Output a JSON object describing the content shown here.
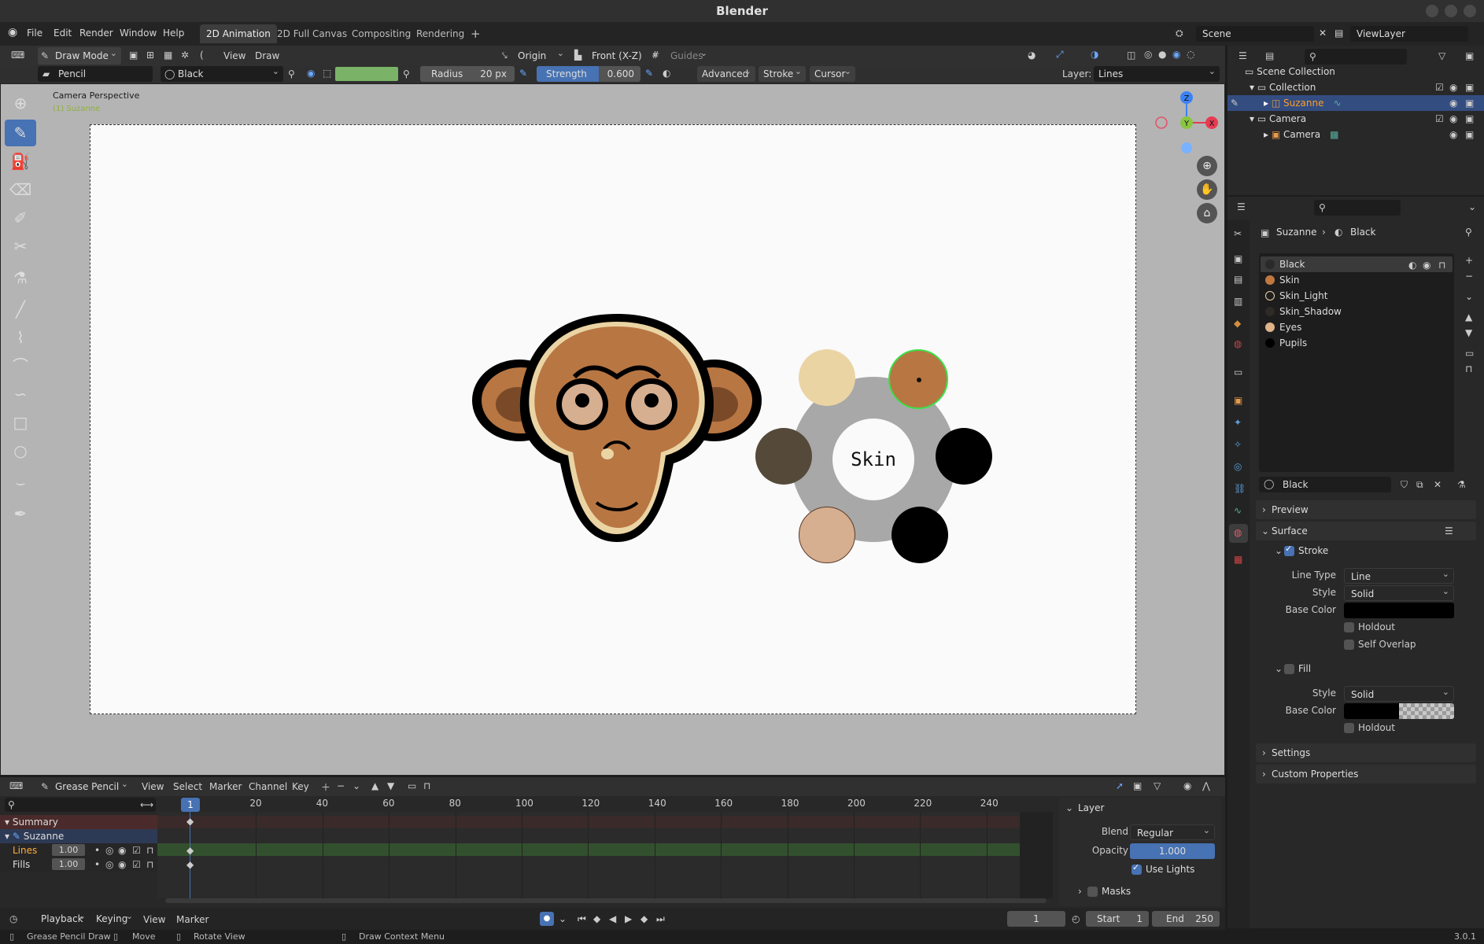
{
  "window": {
    "title": "Blender",
    "version": "3.0.1"
  },
  "menus": [
    "File",
    "Edit",
    "Render",
    "Window",
    "Help"
  ],
  "workspaces": [
    "2D Animation",
    "2D Full Canvas",
    "Compositing",
    "Rendering"
  ],
  "workspace_add": "+",
  "scene": {
    "scene_name": "Scene",
    "view_layer": "ViewLayer"
  },
  "header": {
    "mode": "Draw Mode",
    "view_menu": "View",
    "draw_menu": "Draw",
    "origin": "Origin",
    "projection": "Front (X-Z)",
    "guides": "Guides"
  },
  "tool_settings": {
    "brush": "Pencil",
    "material": "Black",
    "radius_label": "Radius",
    "radius_value": "20 px",
    "strength_label": "Strength",
    "strength_value": "0.600",
    "advanced": "Advanced",
    "stroke": "Stroke",
    "cursor": "Cursor",
    "layer_label": "Layer:",
    "layer_value": "Lines",
    "vertex_color": "#7ab368"
  },
  "viewport": {
    "perspective_label": "Camera Perspective",
    "object_label": "(1) Suzanne",
    "pie_center_label": "Skin",
    "gizmo": {
      "z": "Z",
      "y": "Y",
      "x": "X"
    }
  },
  "pie_colors": {
    "skin_light": "#ebd4a4",
    "skin": "#b87643",
    "skin_shadow": "#554a3a",
    "pupils": "#000000",
    "eyes": "#d6ae90",
    "black": "#000000",
    "ring": "#a8a8a8"
  },
  "outliner": {
    "rows": [
      {
        "label": "Scene Collection"
      },
      {
        "label": "Collection"
      },
      {
        "label": "Suzanne"
      },
      {
        "label": "Camera"
      },
      {
        "label": "Camera"
      }
    ]
  },
  "properties": {
    "breadcrumb_object": "Suzanne",
    "breadcrumb_material": "Black",
    "materials": [
      {
        "name": "Black",
        "color": "#2a2a2a"
      },
      {
        "name": "Skin",
        "color": "#c07840"
      },
      {
        "name": "Skin_Light",
        "color": "#1e1e1e"
      },
      {
        "name": "Skin_Shadow",
        "color": "#2e2a26"
      },
      {
        "name": "Eyes",
        "color": "#e0b488"
      },
      {
        "name": "Pupils",
        "color": "#000000"
      }
    ],
    "material_name": "Black",
    "sections": {
      "preview": "Preview",
      "surface": "Surface",
      "stroke": "Stroke",
      "fill": "Fill",
      "settings": "Settings",
      "custom_properties": "Custom Properties"
    },
    "stroke": {
      "line_type_label": "Line Type",
      "line_type": "Line",
      "style_label": "Style",
      "style": "Solid",
      "base_color_label": "Base Color",
      "holdout": "Holdout",
      "self_overlap": "Self Overlap"
    },
    "fill": {
      "style_label": "Style",
      "style": "Solid",
      "base_color_label": "Base Color",
      "holdout": "Holdout"
    }
  },
  "timeline": {
    "editor": "Grease Pencil",
    "menus": [
      "View",
      "Select",
      "Marker",
      "Channel",
      "Key"
    ],
    "frame_markers": [
      "20",
      "40",
      "60",
      "80",
      "100",
      "120",
      "140",
      "160",
      "180",
      "200",
      "220",
      "240"
    ],
    "current_frame_badge": "1",
    "channels": [
      {
        "label": "Summary"
      },
      {
        "label": "Suzanne"
      },
      {
        "label": "Lines",
        "value": "1.00"
      },
      {
        "label": "Fills",
        "value": "1.00"
      }
    ],
    "layer_panel": {
      "title": "Layer",
      "blend_label": "Blend",
      "blend": "Regular",
      "opacity_label": "Opacity",
      "opacity": "1.000",
      "use_lights": "Use Lights",
      "masks": "Masks"
    }
  },
  "playback": {
    "menus": [
      "Playback",
      "Keying",
      "View",
      "Marker"
    ],
    "current_frame": "1",
    "start_label": "Start",
    "start": "1",
    "end_label": "End",
    "end": "250"
  },
  "status": {
    "left": "Grease Pencil Draw",
    "middle": "Move",
    "rotate": "Rotate View",
    "context": "Draw Context Menu"
  }
}
